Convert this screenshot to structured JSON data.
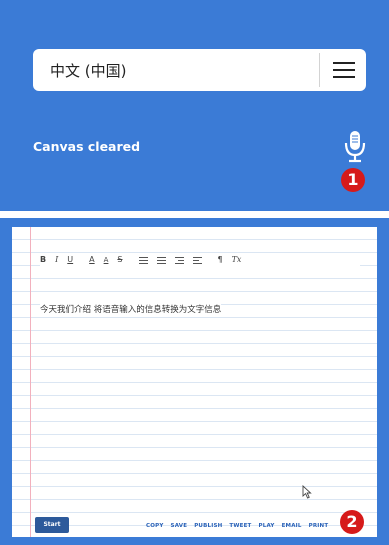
{
  "language_selector": {
    "value": "中文 (中国)",
    "menu_icon": "hamburger-icon"
  },
  "status": {
    "text": "Canvas cleared",
    "icon": "microphone-icon"
  },
  "callouts": [
    "1",
    "2"
  ],
  "toolbar": {
    "bold": "B",
    "italic": "I",
    "underline": "U",
    "font_color": "A",
    "background_color": "A",
    "strikethrough": "S",
    "tools": [
      "bulleted-list",
      "numbered-list",
      "indent",
      "outdent"
    ],
    "paragraph": "¶",
    "clear_format": "Tx"
  },
  "editor": {
    "text": "今天我们介绍 将语音输入的信息转换为文字信息"
  },
  "footer": {
    "start_label": "Start",
    "actions": [
      "COPY",
      "SAVE",
      "PUBLISH",
      "TWEET",
      "PLAY",
      "EMAIL",
      "PRINT"
    ]
  },
  "colors": {
    "panel_blue": "#3b7bd6",
    "start_button": "#2d5a9b",
    "callout_red": "#d61a1a",
    "margin_line": "#f2b0bd"
  }
}
